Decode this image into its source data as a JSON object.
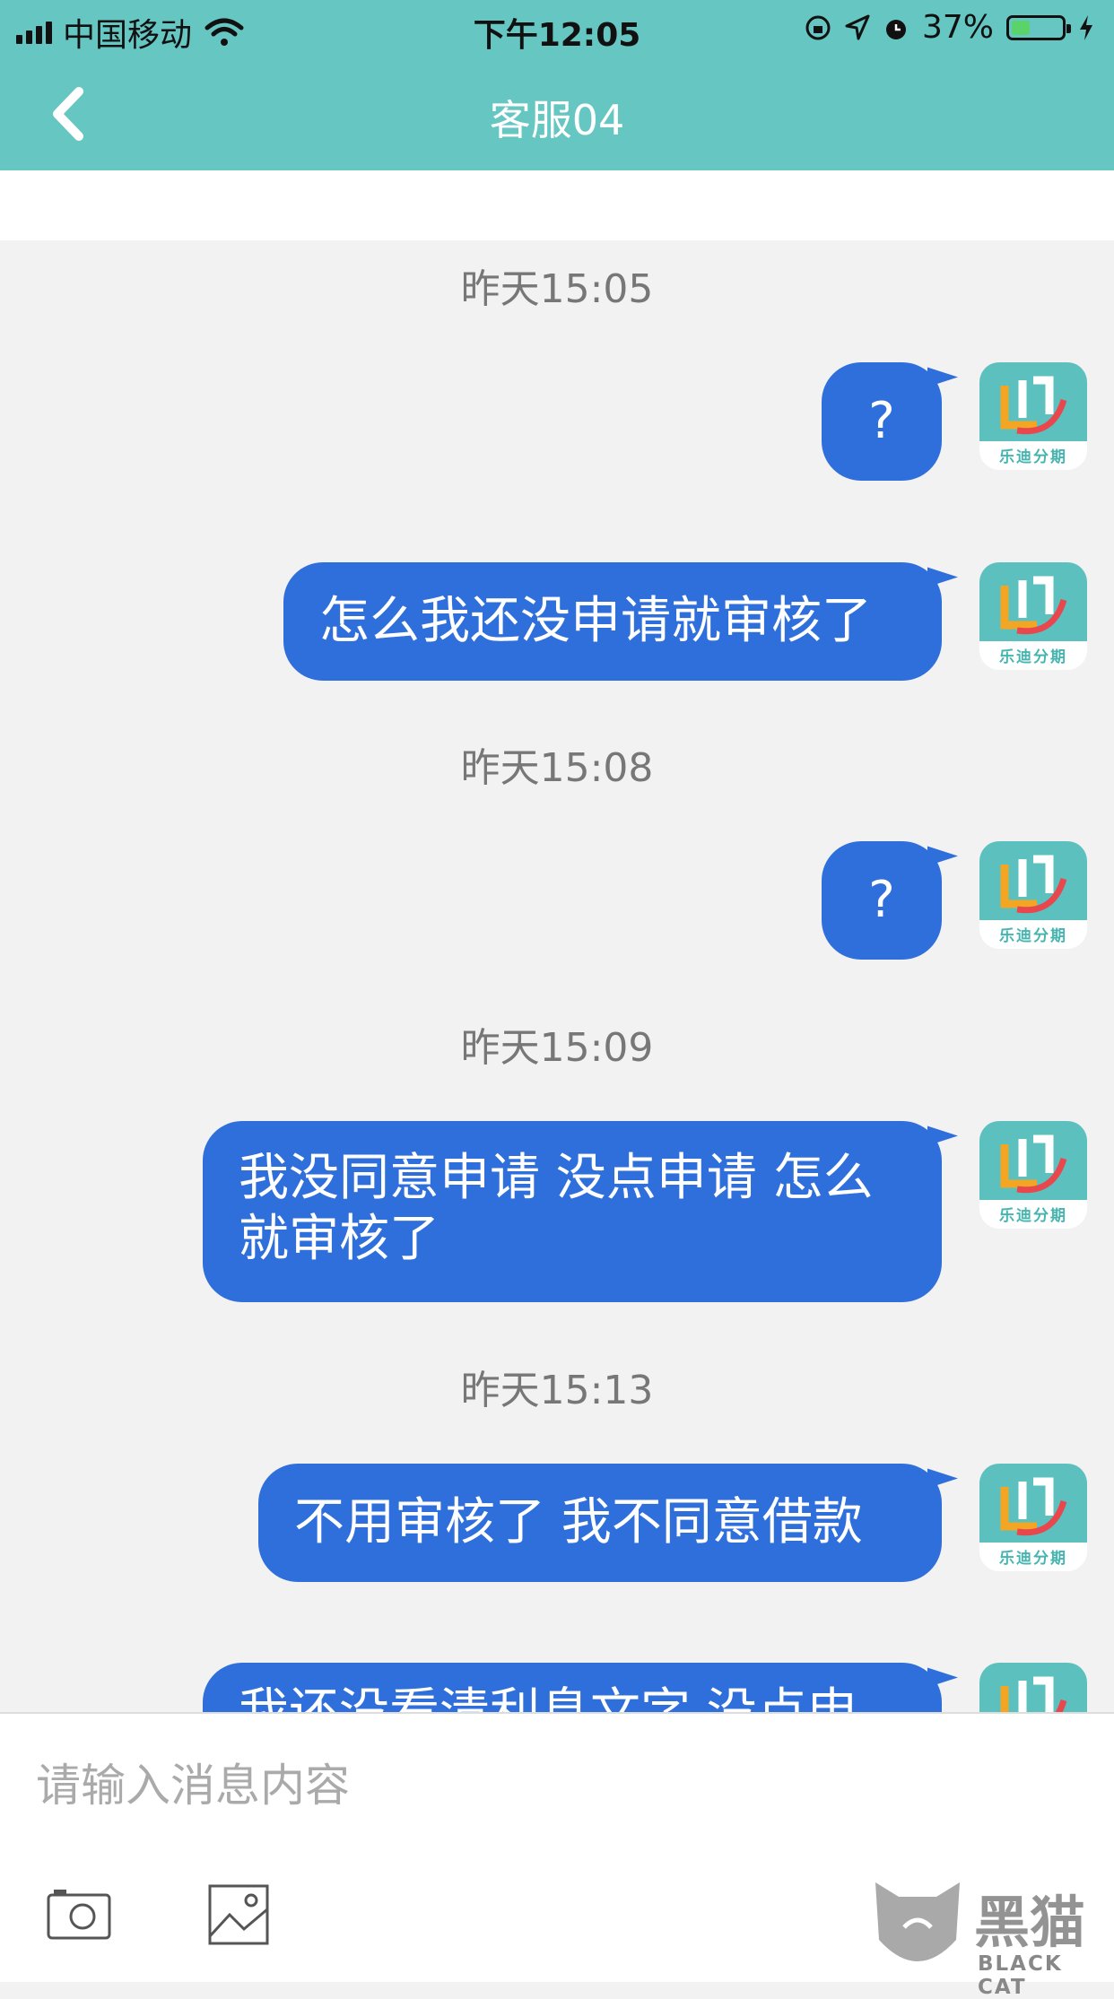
{
  "status": {
    "carrier": "中国移动",
    "time": "下午12:05",
    "battery_pct": "37%",
    "battery_level": 0.37
  },
  "header": {
    "title": "客服04"
  },
  "avatar_label": "乐迪分期",
  "messages": [
    {
      "timestamp": "昨天15:05",
      "texts": [
        "?",
        "怎么我还没申请就审核了"
      ]
    },
    {
      "timestamp": "昨天15:08",
      "texts": [
        "?"
      ]
    },
    {
      "timestamp": "昨天15:09",
      "texts": [
        "我没同意申请 没点申请 怎么\n就审核了"
      ]
    },
    {
      "timestamp": "昨天15:13",
      "texts": [
        "不用审核了 我不同意借款",
        "我还没看清利息文字 没点申"
      ]
    }
  ],
  "input": {
    "placeholder": "请输入消息内容"
  },
  "watermark": {
    "brand": "黑猫",
    "sub": "BLACK CAT"
  },
  "colors": {
    "accent": "#66c6c2",
    "bubble": "#2f6fdb"
  }
}
